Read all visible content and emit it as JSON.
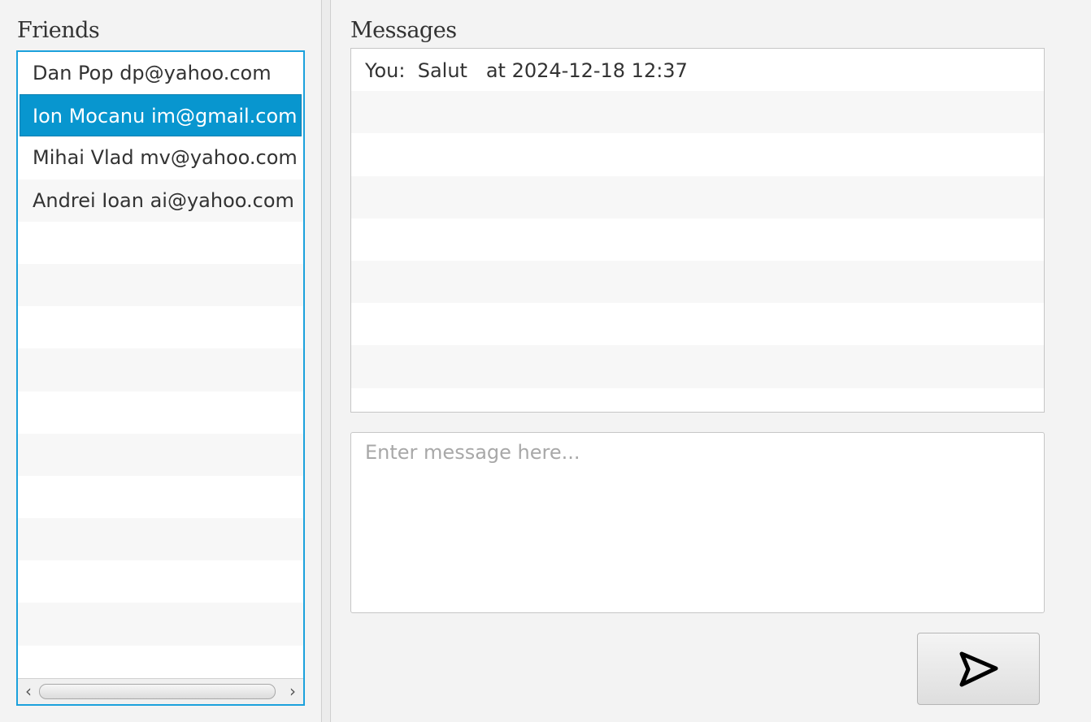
{
  "friends": {
    "title": "Friends",
    "items": [
      {
        "label": "Dan Pop dp@yahoo.com",
        "selected": false
      },
      {
        "label": "Ion Mocanu im@gmail.com",
        "selected": true
      },
      {
        "label": "Mihai Vlad mv@yahoo.com",
        "selected": false
      },
      {
        "label": "Andrei Ioan ai@yahoo.com",
        "selected": false
      }
    ],
    "scroll_left_icon": "chevron-left-icon",
    "scroll_right_icon": "chevron-right-icon"
  },
  "messages": {
    "title": "Messages",
    "items": [
      {
        "text": "You:  Salut   at 2024-12-18 12:37"
      }
    ]
  },
  "composer": {
    "placeholder": "Enter message here...",
    "value": "",
    "send_icon": "send-icon"
  },
  "colors": {
    "accent": "#1ba1dc",
    "selected_row": "#0896cf",
    "background": "#f3f3f3"
  }
}
